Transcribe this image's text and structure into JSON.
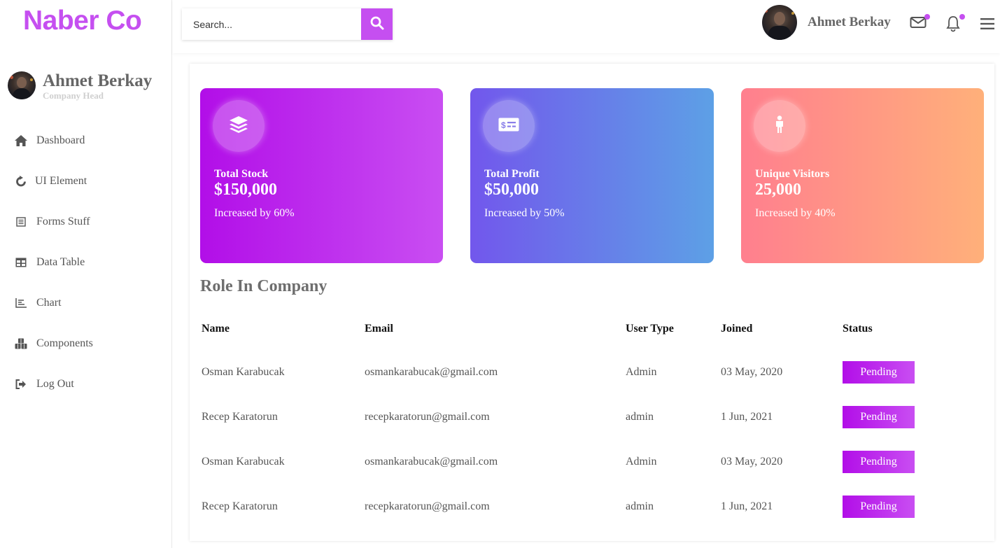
{
  "brand": {
    "name": "Naber Co",
    "color": "#c54ff0"
  },
  "sidebar": {
    "profile": {
      "name": "Ahmet Berkay",
      "role": "Company Head"
    },
    "items": [
      {
        "label": "Dashboard",
        "icon": "home-icon"
      },
      {
        "label": "UI Element",
        "icon": "refresh-icon"
      },
      {
        "label": "Forms Stuff",
        "icon": "form-icon"
      },
      {
        "label": "Data Table",
        "icon": "table-icon"
      },
      {
        "label": "Chart",
        "icon": "chart-icon"
      },
      {
        "label": "Components",
        "icon": "cubes-icon"
      },
      {
        "label": "Log Out",
        "icon": "logout-icon"
      }
    ]
  },
  "topbar": {
    "search": {
      "placeholder": "Search...",
      "value": ""
    },
    "user_name": "Ahmet Berkay",
    "icons": [
      "search-icon",
      "mail-icon",
      "bell-icon",
      "menu-icon"
    ]
  },
  "cards": [
    {
      "title": "Total Stock",
      "value": "$150,000",
      "sub": "Increased by 60%",
      "icon": "layers-icon"
    },
    {
      "title": "Total Profit",
      "value": "$50,000",
      "sub": "Increased by 50%",
      "icon": "money-icon"
    },
    {
      "title": "Unique Visitors",
      "value": "25,000",
      "sub": "Increased by 40%",
      "icon": "person-icon"
    }
  ],
  "role_section": {
    "title": "Role In Company",
    "columns": [
      "Name",
      "Email",
      "User Type",
      "Joined",
      "Status"
    ],
    "rows": [
      {
        "name": "Osman Karabucak",
        "email": "osmankarabucak@gmail.com",
        "type": "Admin",
        "joined": "03 May, 2020",
        "status": "Pending"
      },
      {
        "name": "Recep Karatorun",
        "email": "recepkaratorun@gmail.com",
        "type": "admin",
        "joined": "1 Jun, 2021",
        "status": "Pending"
      },
      {
        "name": "Osman Karabucak",
        "email": "osmankarabucak@gmail.com",
        "type": "Admin",
        "joined": "03 May, 2020",
        "status": "Pending"
      },
      {
        "name": "Recep Karatorun",
        "email": "recepkaratorun@gmail.com",
        "type": "admin",
        "joined": "1 Jun, 2021",
        "status": "Pending"
      }
    ]
  },
  "colors": {
    "accent": "#c54ff0",
    "card1": [
      "#b20ee8",
      "#c94ef2"
    ],
    "card2": [
      "#7257ec",
      "#5da0e6"
    ],
    "card3": [
      "#ff7f8e",
      "#ffb07a"
    ]
  }
}
